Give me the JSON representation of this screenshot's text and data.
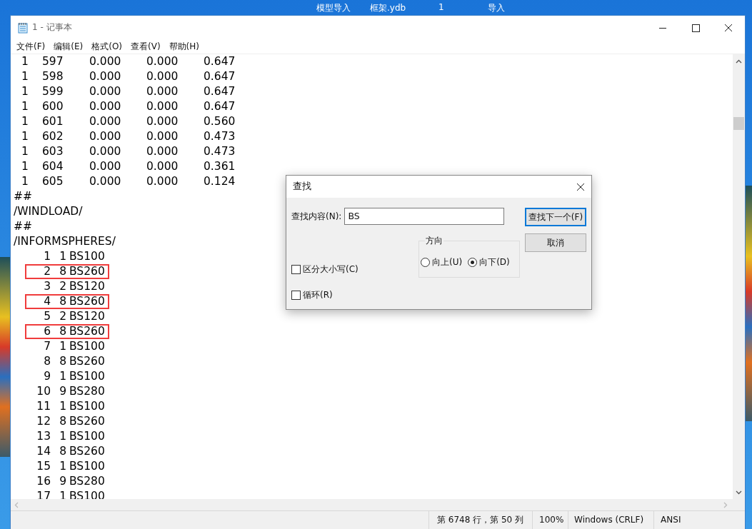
{
  "background_window": {
    "title_items": [
      "模型导入",
      "框架.ydb",
      "1",
      "导入"
    ]
  },
  "notepad": {
    "title": "1 - 记事本",
    "menu": [
      "文件(F)",
      "编辑(E)",
      "格式(O)",
      "查看(V)",
      "帮助(H)"
    ],
    "lines": [
      {
        "kind": "row",
        "cells": [
          "1",
          "597",
          "0.000",
          "0.000",
          "0.647"
        ]
      },
      {
        "kind": "row",
        "cells": [
          "1",
          "598",
          "0.000",
          "0.000",
          "0.647"
        ]
      },
      {
        "kind": "row",
        "cells": [
          "1",
          "599",
          "0.000",
          "0.000",
          "0.647"
        ]
      },
      {
        "kind": "row",
        "cells": [
          "1",
          "600",
          "0.000",
          "0.000",
          "0.647"
        ]
      },
      {
        "kind": "row",
        "cells": [
          "1",
          "601",
          "0.000",
          "0.000",
          "0.560"
        ]
      },
      {
        "kind": "row",
        "cells": [
          "1",
          "602",
          "0.000",
          "0.000",
          "0.473"
        ]
      },
      {
        "kind": "row",
        "cells": [
          "1",
          "603",
          "0.000",
          "0.000",
          "0.473"
        ]
      },
      {
        "kind": "row",
        "cells": [
          "1",
          "604",
          "0.000",
          "0.000",
          "0.361"
        ]
      },
      {
        "kind": "row",
        "cells": [
          "1",
          "605",
          "0.000",
          "0.000",
          "0.124"
        ]
      },
      {
        "kind": "text",
        "text": "##"
      },
      {
        "kind": "text",
        "text": "/WINDLOAD/"
      },
      {
        "kind": "text",
        "text": "##"
      },
      {
        "kind": "text",
        "text": "/INFORMSPHERES/"
      },
      {
        "kind": "sphere",
        "cells": [
          "1",
          "1",
          "BS100"
        ],
        "boxed": false
      },
      {
        "kind": "sphere",
        "cells": [
          "2",
          "8",
          "BS260"
        ],
        "boxed": true
      },
      {
        "kind": "sphere",
        "cells": [
          "3",
          "2",
          "BS120"
        ],
        "boxed": false
      },
      {
        "kind": "sphere",
        "cells": [
          "4",
          "8",
          "BS260"
        ],
        "boxed": true
      },
      {
        "kind": "sphere",
        "cells": [
          "5",
          "2",
          "BS120"
        ],
        "boxed": false
      },
      {
        "kind": "sphere",
        "cells": [
          "6",
          "8",
          "BS260"
        ],
        "boxed": true
      },
      {
        "kind": "sphere",
        "cells": [
          "7",
          "1",
          "BS100"
        ],
        "boxed": false
      },
      {
        "kind": "sphere",
        "cells": [
          "8",
          "8",
          "BS260"
        ],
        "boxed": false
      },
      {
        "kind": "sphere",
        "cells": [
          "9",
          "1",
          "BS100"
        ],
        "boxed": false
      },
      {
        "kind": "sphere",
        "cells": [
          "10",
          "9",
          "BS280"
        ],
        "boxed": false
      },
      {
        "kind": "sphere",
        "cells": [
          "11",
          "1",
          "BS100"
        ],
        "boxed": false
      },
      {
        "kind": "sphere",
        "cells": [
          "12",
          "8",
          "BS260"
        ],
        "boxed": false
      },
      {
        "kind": "sphere",
        "cells": [
          "13",
          "1",
          "BS100"
        ],
        "boxed": false
      },
      {
        "kind": "sphere",
        "cells": [
          "14",
          "8",
          "BS260"
        ],
        "boxed": false
      },
      {
        "kind": "sphere",
        "cells": [
          "15",
          "1",
          "BS100"
        ],
        "boxed": false
      },
      {
        "kind": "sphere",
        "cells": [
          "16",
          "9",
          "BS280"
        ],
        "boxed": false
      },
      {
        "kind": "sphere",
        "cells": [
          "17",
          "1",
          "BS100"
        ],
        "boxed": false
      }
    ],
    "status_bar": [
      "第 6748 行，第 50 列",
      "100%",
      "Windows (CRLF)",
      "ANSI"
    ]
  },
  "find_dialog": {
    "title": "查找",
    "find_label": "查找内容(N):",
    "find_value": "BS",
    "buttons": [
      {
        "label": "查找下一个(F)",
        "default": true
      },
      {
        "label": "取消",
        "default": false
      }
    ],
    "checkboxes": [
      {
        "label": "区分大小写(C)",
        "checked": false
      },
      {
        "label": "循环(R)",
        "checked": false
      }
    ],
    "direction": {
      "label": "方向",
      "options": [
        {
          "label": "向上(U)",
          "selected": false
        },
        {
          "label": "向下(D)",
          "selected": true
        }
      ]
    }
  }
}
